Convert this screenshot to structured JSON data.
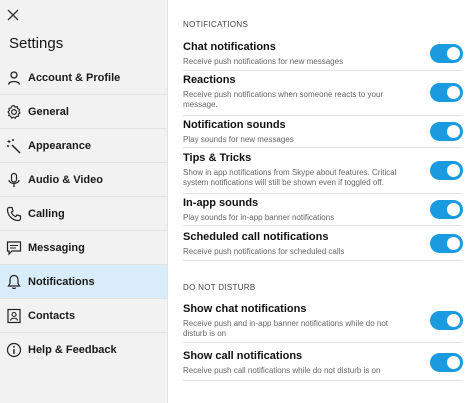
{
  "sidebar": {
    "title": "Settings",
    "items": [
      {
        "label": "Account & Profile",
        "icon": "person-icon"
      },
      {
        "label": "General",
        "icon": "gear-icon"
      },
      {
        "label": "Appearance",
        "icon": "magic-wand-icon"
      },
      {
        "label": "Audio & Video",
        "icon": "microphone-icon"
      },
      {
        "label": "Calling",
        "icon": "phone-icon"
      },
      {
        "label": "Messaging",
        "icon": "chat-icon"
      },
      {
        "label": "Notifications",
        "icon": "bell-icon",
        "active": true
      },
      {
        "label": "Contacts",
        "icon": "contact-card-icon"
      },
      {
        "label": "Help & Feedback",
        "icon": "info-icon"
      }
    ]
  },
  "main": {
    "notifications_header": "NOTIFICATIONS",
    "dnd_header": "DO NOT DISTURB",
    "settings": [
      {
        "title": "Chat notifications",
        "desc": "Receive push notifications for new messages",
        "on": true
      },
      {
        "title": "Reactions",
        "desc": "Receive push notifications when someone reacts to your message.",
        "on": true
      },
      {
        "title": "Notification sounds",
        "desc": "Play sounds for new messages",
        "on": true
      },
      {
        "title": "Tips & Tricks",
        "desc": "Show in app notifications from Skype about features. Critical system notifications will still be shown even if toggled off.",
        "on": true
      },
      {
        "title": "In-app sounds",
        "desc": "Play sounds for in-app banner notifications",
        "on": true
      },
      {
        "title": "Scheduled call notifications",
        "desc": "Receive push notifications for scheduled calls",
        "on": true
      }
    ],
    "dnd_settings": [
      {
        "title": "Show chat notifications",
        "desc": "Receive push and in-app banner notifications while do not disturb is on",
        "on": true
      },
      {
        "title": "Show call notifications",
        "desc": "Receive push call notifications while do not disturb is on",
        "on": true
      }
    ]
  },
  "colors": {
    "accent": "#1a9be0",
    "active_nav": "#d8ecfa",
    "sidebar_bg": "#f2f2f2"
  }
}
